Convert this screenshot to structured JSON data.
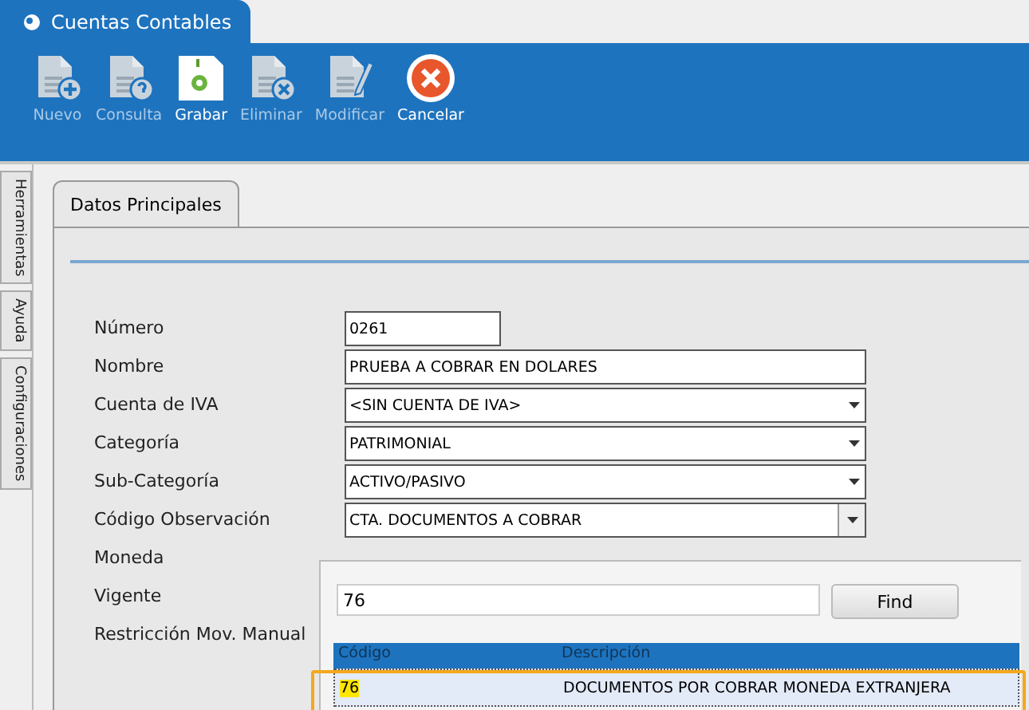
{
  "window": {
    "title": "Cuentas Contables"
  },
  "toolbar": [
    {
      "label": "Nuevo",
      "kind": "new",
      "disabled": true
    },
    {
      "label": "Consulta",
      "kind": "query",
      "disabled": true
    },
    {
      "label": "Grabar",
      "kind": "save",
      "disabled": false
    },
    {
      "label": "Eliminar",
      "kind": "delete",
      "disabled": true
    },
    {
      "label": "Modificar",
      "kind": "edit",
      "disabled": true
    },
    {
      "label": "Cancelar",
      "kind": "cancel",
      "disabled": false
    }
  ],
  "side_tabs": [
    {
      "label": "Herramientas"
    },
    {
      "label": "Ayuda"
    },
    {
      "label": "Configuraciones"
    }
  ],
  "tabs": [
    {
      "label": "Datos Principales",
      "selected": true
    }
  ],
  "form": [
    {
      "label": "Número",
      "kind": "text",
      "value": "0261",
      "short": true
    },
    {
      "label": "Nombre",
      "kind": "text",
      "value": "PRUEBA A COBRAR EN DOLARES"
    },
    {
      "label": "Cuenta de IVA",
      "kind": "select",
      "value": "<SIN CUENTA DE IVA>"
    },
    {
      "label": "Categoría",
      "kind": "select",
      "value": "PATRIMONIAL"
    },
    {
      "label": "Sub-Categoría",
      "kind": "select",
      "value": "ACTIVO/PASIVO"
    },
    {
      "label": "Código Observación",
      "kind": "combo",
      "value": "CTA. DOCUMENTOS A COBRAR",
      "expanded": true
    },
    {
      "label": "Moneda",
      "kind": "none"
    },
    {
      "label": "Vigente",
      "kind": "none"
    },
    {
      "label": "Restricción Mov. Manual",
      "kind": "none"
    }
  ],
  "lookup": {
    "search": "76",
    "button": "Find",
    "columns": [
      "Código",
      "Descripción"
    ],
    "rows": [
      {
        "code": "76",
        "description": "DOCUMENTOS POR COBRAR MONEDA EXTRANJERA",
        "selected": true,
        "match": true,
        "outlined": true
      }
    ]
  }
}
